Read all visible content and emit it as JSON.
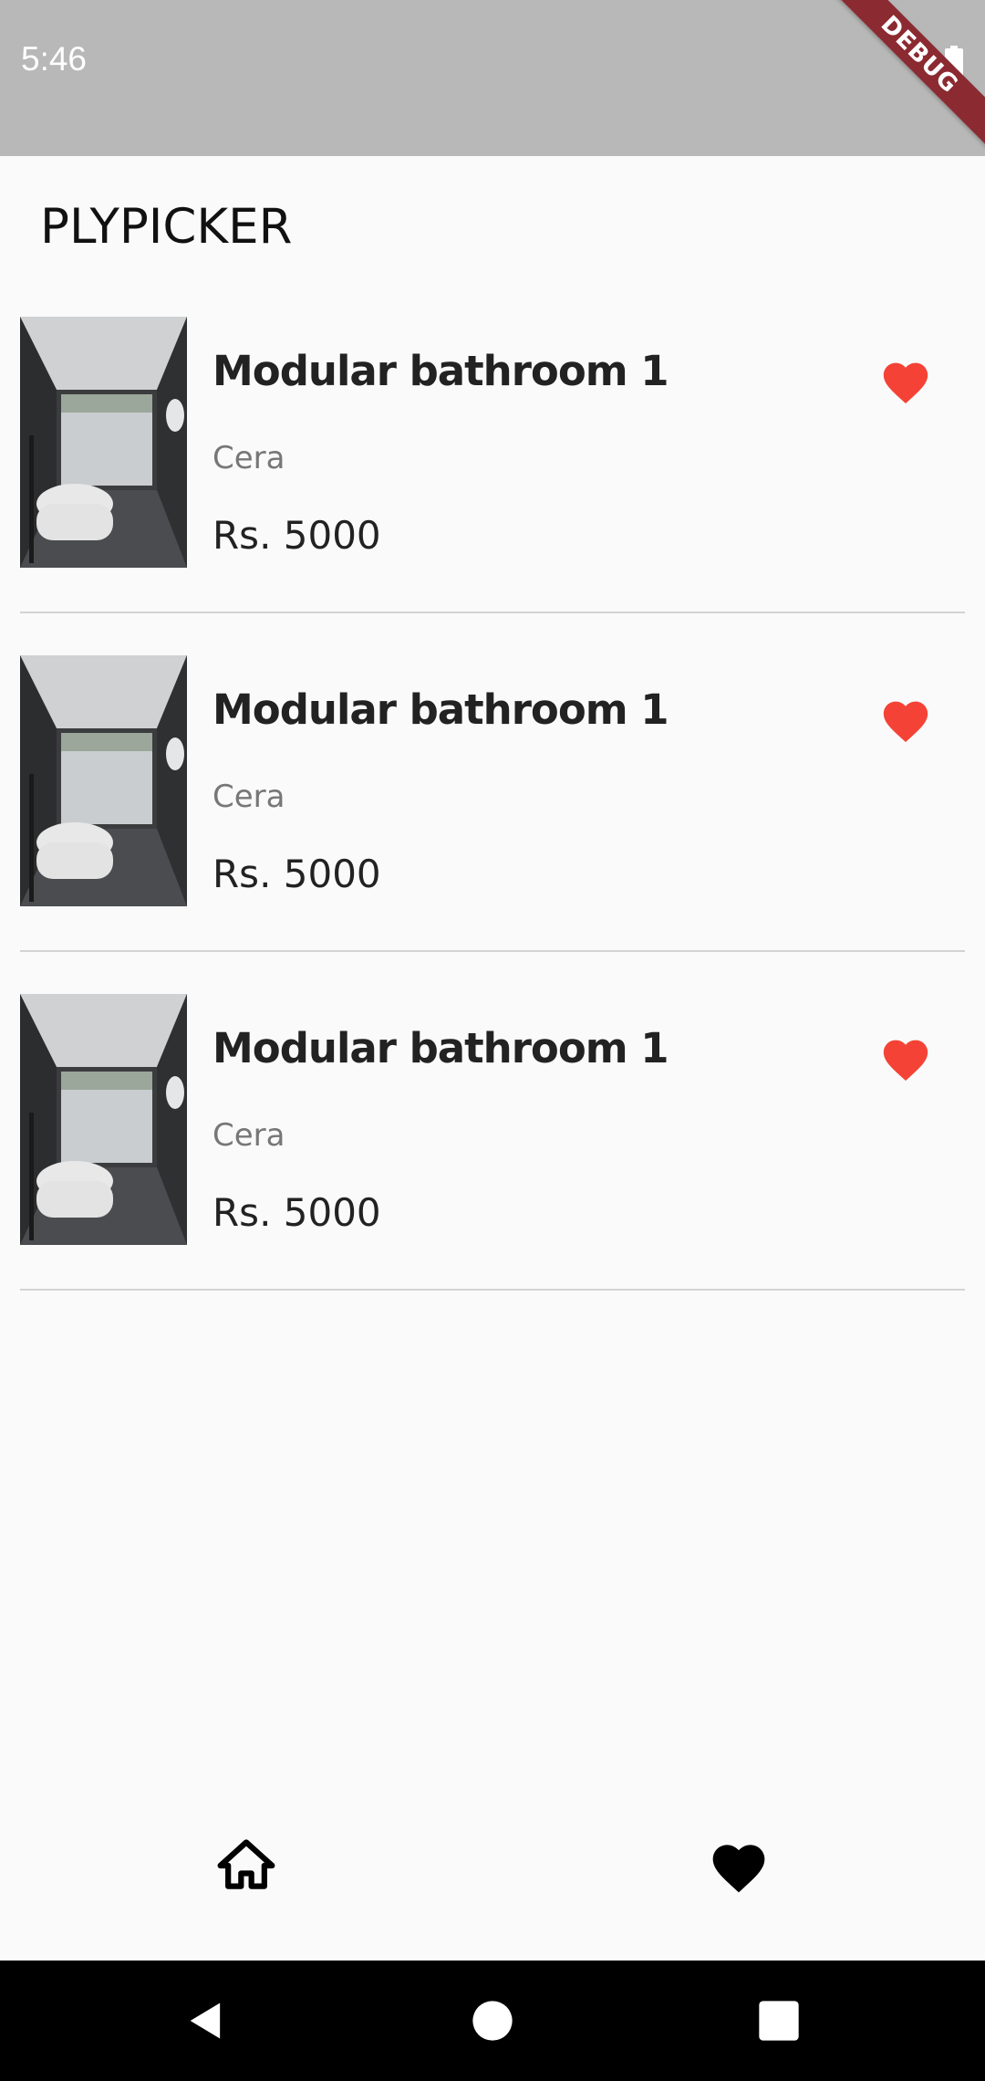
{
  "status_bar": {
    "time": "5:46",
    "debug_label": "DEBUG",
    "icons": [
      "battery-icon"
    ]
  },
  "app": {
    "title": "PLYPICKER"
  },
  "products": [
    {
      "name": "Modular bathroom 1",
      "brand": "Cera",
      "price": "Rs. 5000",
      "favorite": true,
      "image": "bathroom-photo"
    },
    {
      "name": "Modular bathroom 1",
      "brand": "Cera",
      "price": "Rs. 5000",
      "favorite": true,
      "image": "bathroom-photo"
    },
    {
      "name": "Modular bathroom 1",
      "brand": "Cera",
      "price": "Rs. 5000",
      "favorite": true,
      "image": "bathroom-photo"
    }
  ],
  "bottom_nav": {
    "items": [
      "home-icon",
      "heart-icon"
    ]
  },
  "colors": {
    "status_bar": "#b8b8b8",
    "debug_banner": "#8b2a31",
    "favorite": "#f44336",
    "background": "#fafafa",
    "divider": "#d3d3d3"
  }
}
